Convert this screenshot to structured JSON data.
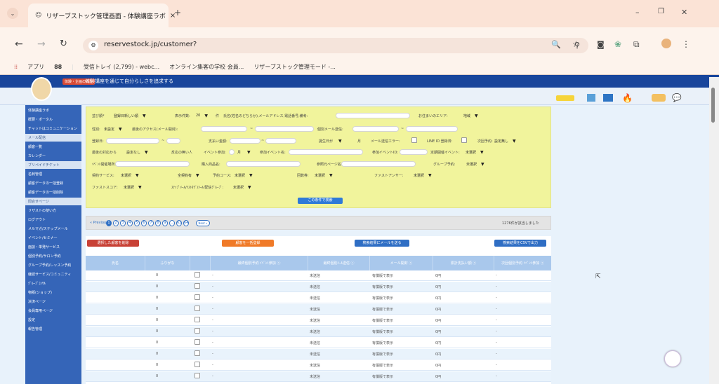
{
  "browser": {
    "tab_title": "リザーブストック管理画面 - 体験講座ラボ",
    "tab_close": "×",
    "new_tab": "+",
    "url": "reservestock.jp/customer?",
    "bookmarks": [
      "アプリ",
      "受信トレイ (2,799) - webc...",
      "オンライン集客の学校 会員...",
      "リザーブストック管理モード -..."
    ]
  },
  "site": {
    "banner_tag": "体験・企画の先生",
    "banner_text": "体験講座を通じて自分らしさを追求する"
  },
  "sidebar": {
    "items": [
      {
        "label": "体験講座ラボ",
        "light": false
      },
      {
        "label": "概要・ポータル",
        "light": false
      },
      {
        "label": "チャットはコミュニケーション",
        "light": false
      },
      {
        "label": "メール配信",
        "light": true
      },
      {
        "label": "顧客一覧",
        "light": false
      },
      {
        "label": "カレンダー",
        "light": false
      },
      {
        "label": "ブリペイドチケット",
        "light": true
      },
      {
        "label": "名刺管理",
        "light": false
      },
      {
        "label": "顧客データの一括登録",
        "light": false
      },
      {
        "label": "顧客データの一括削除",
        "light": false
      },
      {
        "label": "問合せページ",
        "light": true
      },
      {
        "label": "リザストの使い方",
        "light": false
      },
      {
        "label": "ログアウト",
        "light": false
      },
      {
        "label": "メルマガ/ステップメール",
        "light": false
      },
      {
        "label": "イベント/セミナー",
        "light": false
      },
      {
        "label": "面談・単発サービス",
        "light": false
      },
      {
        "label": "個別予約/サロン予約",
        "light": false
      },
      {
        "label": "グループ予約/レッスン予約",
        "light": false
      },
      {
        "label": "継続サービス/コミュニティ",
        "light": false
      },
      {
        "label": "ｸﾞﾙｰﾌﾟｺﾝｻﾙ",
        "light": false
      },
      {
        "label": "物販(ショップ)",
        "light": false
      },
      {
        "label": "決済ページ",
        "light": false
      },
      {
        "label": "会員専用ページ",
        "light": false
      },
      {
        "label": "設定",
        "light": false
      },
      {
        "label": "報告管理",
        "light": false
      }
    ]
  },
  "filter": {
    "sort_label": "並び順*",
    "sort_value": "登録日新しい順",
    "count_label": "表示件数:",
    "count_value": "20",
    "count_unit": "件",
    "name_label": "氏名(姓名のどちらか),メールアドレス,電話番号,備考:",
    "area_label": "お住まいのエリア:",
    "area_value": "地域",
    "gender_label": "性別:",
    "gender_value": "未設定",
    "last_access_label": "最後のアクセス(メール開封):",
    "tilde": "~",
    "contact_label": "個別メール送信:",
    "reg_label": "登録日:",
    "payment_label": "支払い金額:",
    "birth_label": "誕生日が",
    "birth_unit": "月",
    "mail_error_label": "メール送信エラー:",
    "line_label": "LINE ID 登録済:",
    "next_label": "次回予約:",
    "next_value": "設定無し",
    "last_label": "最後の対応から",
    "last_value": "設定なし",
    "response_label": "反応の無い人",
    "event_label": "イベント参加:",
    "event_value": "月",
    "event_name_label": "参加イベント名:",
    "event_id_label": "参加イベントID:",
    "fixed_label": "定期開催イベント:",
    "fixed_value": "未選択",
    "venue_label": "ｲﾍﾞﾝﾄ開催場所:",
    "product_label": "購入商品名:",
    "page_label": "参照元ページ名:",
    "group_label": "グループ予約:",
    "group_value": "未選択",
    "contract_label": "契約サービス:",
    "contract_value": "未選択",
    "all_value": "全契約有",
    "course_label": "予約コース:",
    "course_value": "未選択",
    "answer_label": "回数券:",
    "answer_value": "未選択",
    "first_label": "ファストアンサー:",
    "first_value": "未選択",
    "score_label": "ファストスコア:",
    "score_value": "未選択",
    "list_label": "ｽﾃｯﾌﾟﾒｰﾙ/ﾘｽﾄﾀｸﾞ/ﾒｰﾙ/配信ｸﾞﾙｰﾌﾟ:",
    "list_value": "未選択",
    "search_button": "この条件で検索"
  },
  "pager": {
    "prev": "« Previous",
    "pages": [
      "1",
      "2",
      "3",
      "4",
      "5",
      "6",
      "7",
      "8",
      "9",
      "...",
      "63",
      "64"
    ],
    "next": "Next »",
    "result": "1276件が該当しました"
  },
  "actions": {
    "delete_button": "選択した顧客を削除",
    "bulk_button": "顧客を一括登録",
    "mail_button": "検索結果にメールを送る",
    "csv_button": "検索結果をCSVで出力"
  },
  "table": {
    "headers": [
      "氏名",
      "ふりがな",
      "",
      "最終個別予約 ｲﾍﾞﾝﾄ参加 ⓢ",
      "最終個別ﾒｰﾙ送信 ⓢ",
      "メール開封 ⓢ",
      "累計支払い額 ⓢ",
      "次回個別予約 ｲﾍﾞﾝﾄ参加 ⓢ"
    ],
    "rows": [
      {
        "col1": "0",
        "col2": "-",
        "col3": "未送信",
        "col4": "有償版で表示",
        "col5": "0円",
        "col6": "-"
      },
      {
        "col1": "0",
        "col2": "-",
        "col3": "未送信",
        "col4": "有償版で表示",
        "col5": "0円",
        "col6": "-"
      },
      {
        "col1": "0",
        "col2": "-",
        "col3": "未送信",
        "col4": "有償版で表示",
        "col5": "0円",
        "col6": "-"
      },
      {
        "col1": "0",
        "col2": "-",
        "col3": "未送信",
        "col4": "有償版で表示",
        "col5": "0円",
        "col6": "-"
      },
      {
        "col1": "0",
        "col2": "-",
        "col3": "未送信",
        "col4": "有償版で表示",
        "col5": "0円",
        "col6": "-"
      },
      {
        "col1": "0",
        "col2": "-",
        "col3": "未送信",
        "col4": "有償版で表示",
        "col5": "0円",
        "col6": "-"
      },
      {
        "col1": "0",
        "col2": "-",
        "col3": "未送信",
        "col4": "有償版で表示",
        "col5": "0円",
        "col6": "-"
      },
      {
        "col1": "0",
        "col2": "-",
        "col3": "未送信",
        "col4": "有償版で表示",
        "col5": "0円",
        "col6": "-"
      },
      {
        "col1": "0",
        "col2": "-",
        "col3": "未送信",
        "col4": "有償版で表示",
        "col5": "0円",
        "col6": "-"
      },
      {
        "col1": "0",
        "col2": "-",
        "col3": "未送信",
        "col4": "有償版で表示",
        "col5": "0円",
        "col6": "-"
      }
    ]
  }
}
